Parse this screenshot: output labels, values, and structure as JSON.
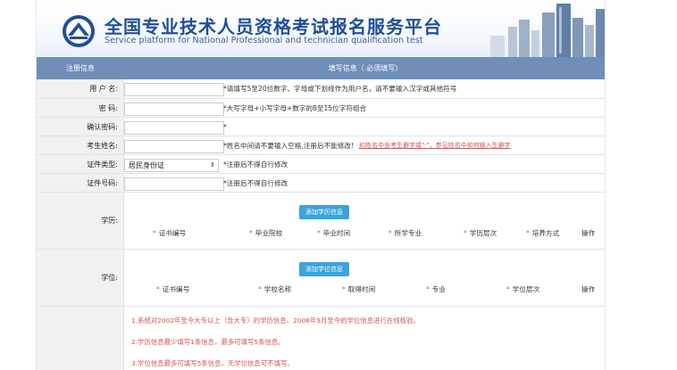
{
  "header": {
    "title": "全国专业技术人员资格考试报名服务平台",
    "subtitle": "Service platform for National Professional and technician qualification test"
  },
  "section": {
    "left_label": "注册信息",
    "right_label": "填写信息（ 必须填写）"
  },
  "fields": [
    {
      "label": "用 户 名:",
      "value": "",
      "hint": "*请填写5至20位数字、字母或下划线作为用户名，请不要输入汉字或其他符号"
    },
    {
      "label": "密    码:",
      "value": "",
      "hint": "*大写字母+小写字母+数字的8至15位字符组合"
    },
    {
      "label": "确认密码:",
      "value": "",
      "hint": "*"
    },
    {
      "label": "考生姓名:",
      "value": "",
      "hint": "*姓名中间请不要输入空格,注册后不能修改!",
      "link": "如姓名中含考生僻字或\"·\"，参见姓名中如何输入生僻字"
    },
    {
      "label": "证件类型:",
      "value": "居民身份证",
      "hint": "*注册后不得自行修改"
    },
    {
      "label": "证件号码:",
      "value": "",
      "hint": "*注册后不得自行修改"
    }
  ],
  "education": {
    "label": "学历:",
    "add_button": "添加学历信息",
    "columns": [
      "证书编号",
      "毕业院校",
      "毕业时间",
      "所学专业",
      "学历层次",
      "培养方式"
    ],
    "actions": "操作"
  },
  "degree": {
    "label": "学位:",
    "add_button": "添加学位信息",
    "columns": [
      "证书编号",
      "学校名称",
      "取得时间",
      "专业",
      "学位层次"
    ],
    "actions": "操作"
  },
  "notes": [
    "1.系统对2002年至今大专以上（含大专）的学历信息、2008年9月至今的学位信息进行在线核验。",
    "2.学历信息最少填写1条信息，最多可填写5条信息。",
    "3.学位信息最多可填写5条信息，无学位信息可不填写。"
  ],
  "colors": {
    "section_bar": "#6f8fb8",
    "title": "#1f4f96",
    "button": "#3aa4dd",
    "warning": "#d9534f"
  }
}
